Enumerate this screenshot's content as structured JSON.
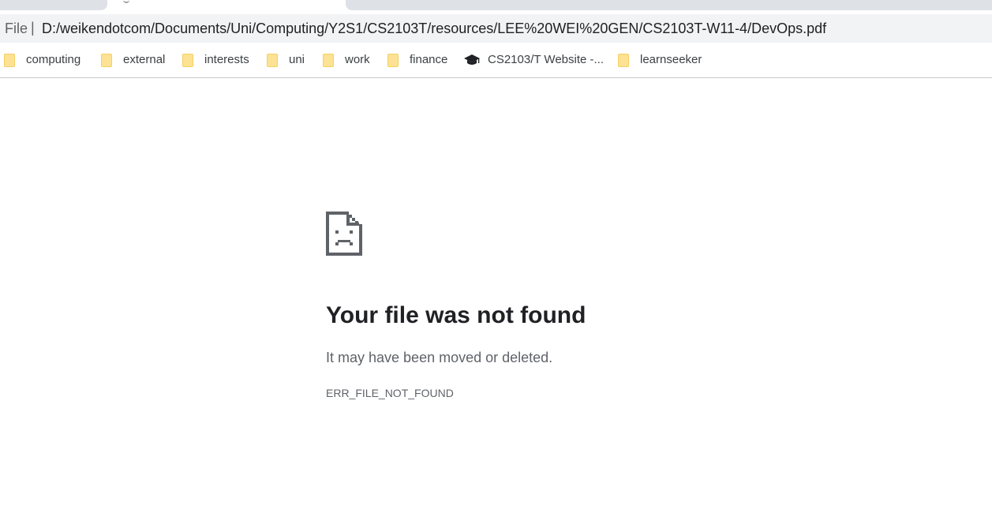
{
  "browser": {
    "omnibox": {
      "scheme_label": "File",
      "separator": "|",
      "url": "D:/weikendotcom/Documents/Uni/Computing/Y2S1/CS2103T/resources/LEE%20WEI%20GEN/CS2103T-W11-4/DevOps.pdf"
    },
    "bookmarks": [
      {
        "label": "computing",
        "icon": "folder-icon"
      },
      {
        "label": "external",
        "icon": "folder-icon"
      },
      {
        "label": "interests",
        "icon": "folder-icon"
      },
      {
        "label": "uni",
        "icon": "folder-icon"
      },
      {
        "label": "work",
        "icon": "folder-icon"
      },
      {
        "label": "finance",
        "icon": "folder-icon"
      },
      {
        "label": "CS2103/T Website -...",
        "icon": "graduation-cap-icon"
      },
      {
        "label": "learnseeker",
        "icon": "folder-icon"
      }
    ]
  },
  "error_page": {
    "icon": "sad-file-icon",
    "title": "Your file was not found",
    "message": "It may have been moved or deleted.",
    "error_code": "ERR_FILE_NOT_FOUND"
  },
  "colors": {
    "folder": "#fde293",
    "text_primary": "#202124",
    "text_secondary": "#5f6368",
    "omnibox_bg": "#f1f3f4"
  }
}
